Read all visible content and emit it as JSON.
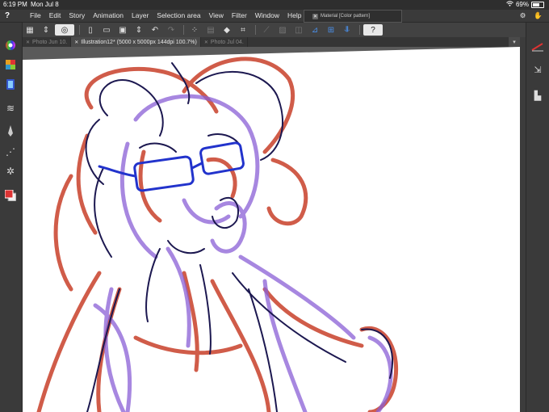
{
  "status_bar": {
    "time": "6:19 PM",
    "date": "Mon Jul 8",
    "battery": "69%"
  },
  "menu": {
    "logo": "?",
    "items": [
      "File",
      "Edit",
      "Story",
      "Animation",
      "Layer",
      "Selection area",
      "View",
      "Filter",
      "Window",
      "Help"
    ]
  },
  "material_palette": {
    "title": "Material [Color pattern]"
  },
  "tabs": [
    {
      "label": "Photo Jun 10.",
      "active": false
    },
    {
      "label": "Illustration12* (5000 x 5000px 144dpi 100.7%)",
      "active": true
    },
    {
      "label": "Photo Jul 04.",
      "active": false
    }
  ],
  "colors": {
    "sketch_red": "#c8402a",
    "sketch_purple": "#8a5fd6",
    "lineart_navy": "#1c1850",
    "glasses_blue": "#2233cc",
    "accent_blue": "#4a8fe8"
  },
  "icons": {
    "help": "question-mark",
    "right_top": "pen-tool-icon"
  }
}
